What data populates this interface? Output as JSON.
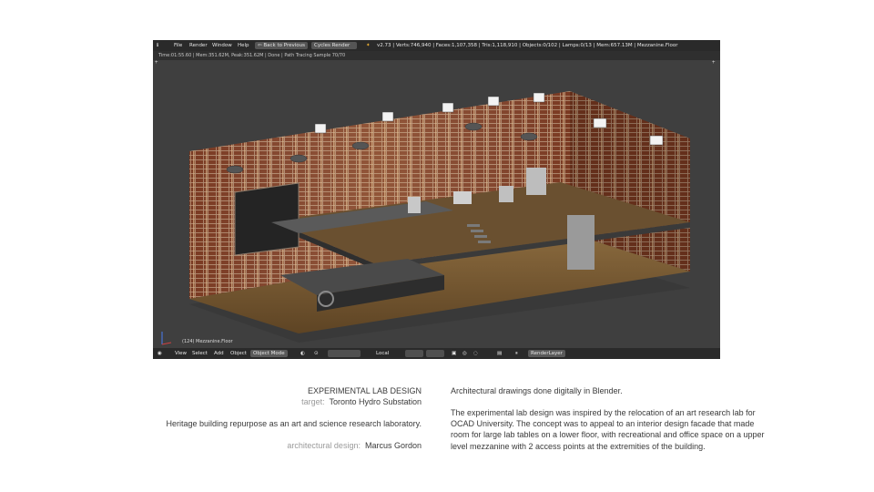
{
  "blender": {
    "menu": [
      "File",
      "Render",
      "Window",
      "Help"
    ],
    "back_button": "Back to Previous",
    "engine": "Cycles Render",
    "stats": "v2.73 | Verts:746,940 | Faces:1,107,358 | Tris:1,118,910 | Objects:0/102 | Lamps:0/13 | Mem:657.13M | Mezzanine.Floor",
    "render_status": "Time:01:55.60 | Mem:351.62M, Peak:351.62M | Done | Path Tracing Sample 70/70",
    "viewport_label": "(124) Mezzanine.Floor",
    "bottom_menu": [
      "View",
      "Select",
      "Add",
      "Object"
    ],
    "mode": "Object Mode",
    "pivot": "Local",
    "render_layer": "RenderLayer"
  },
  "caption": {
    "title": "EXPERIMENTAL LAB DESIGN",
    "target_label": "target:",
    "target_value": "Toronto Hydro Substation",
    "summary": "Heritage building repurpose as an art and science research laboratory.",
    "designer_label": "architectural design:",
    "designer_value": "Marcus Gordon"
  },
  "description": {
    "intro": "Architectural drawings done digitally in Blender.",
    "body": "The experimental lab design was inspired by the relocation of an art research lab for OCAD University.  The concept was to appeal to an interior design facade that made room for large lab tables on a lower floor, with recreational and office space on a upper level mezzanine with 2 access points at the extremities of the building."
  }
}
